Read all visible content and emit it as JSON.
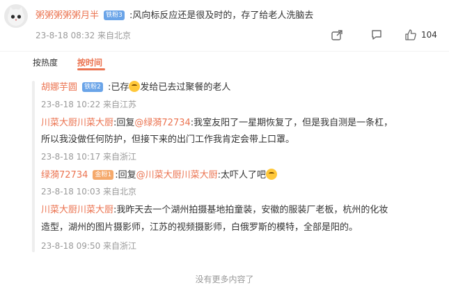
{
  "main_comment": {
    "username": "粥粥粥粥粥月半",
    "badge": "铁粉3",
    "text": ":风向标反应还是很及时的，存了给老人洗脑去",
    "timestamp": "23-8-18 08:32 来自北京",
    "like_count": "104"
  },
  "sort": {
    "by_hot": "按热度",
    "by_time": "按时间"
  },
  "replies": [
    {
      "username": "胡娜芋圆",
      "badge": "铁粉2",
      "text_before_emoji": ":已存",
      "text_after_emoji": "发给已去过聚餐的老人",
      "timestamp": "23-8-18 10:22 来自江苏"
    },
    {
      "username": "川菜大厨川菜大厨",
      "reply_prefix": ":回复",
      "mention": "@绿漪72734",
      "text_line1": ":我室友阳了一星期恢复了，但是我自测是一条杠，",
      "text_line2": "所以我没做任何防护，但接下来的出门工作我肯定会带上口罩。",
      "timestamp": "23-8-18 10:17 来自浙江"
    },
    {
      "username": "绿漪72734",
      "badge": "金粉1",
      "reply_prefix": ":回复",
      "mention": "@川菜大厨川菜大厨",
      "text": ":太吓人了吧",
      "timestamp": "23-8-18 10:03 来自北京"
    },
    {
      "username": "川菜大厨川菜大厨",
      "text_line1": ":我昨天去一个湖州拍摄基地拍童装，安徽的服装厂老板，杭州的化妆",
      "text_line2": "造型，湖州的图片摄影师，江苏的视频摄影师，白俄罗斯的模特，全部是阳的。",
      "timestamp": "23-8-18 09:50 来自浙江"
    }
  ],
  "footer": {
    "no_more": "没有更多内容了"
  },
  "colors": {
    "accent": "#eb7350",
    "meta": "#9a9a9a",
    "badge_blue": "#6aa4e8",
    "badge_orange": "#f5a96b"
  },
  "icons": [
    "cat-avatar-icon",
    "share-icon",
    "comment-icon",
    "like-icon",
    "shock-emoji-icon",
    "cry-emoji-icon"
  ]
}
